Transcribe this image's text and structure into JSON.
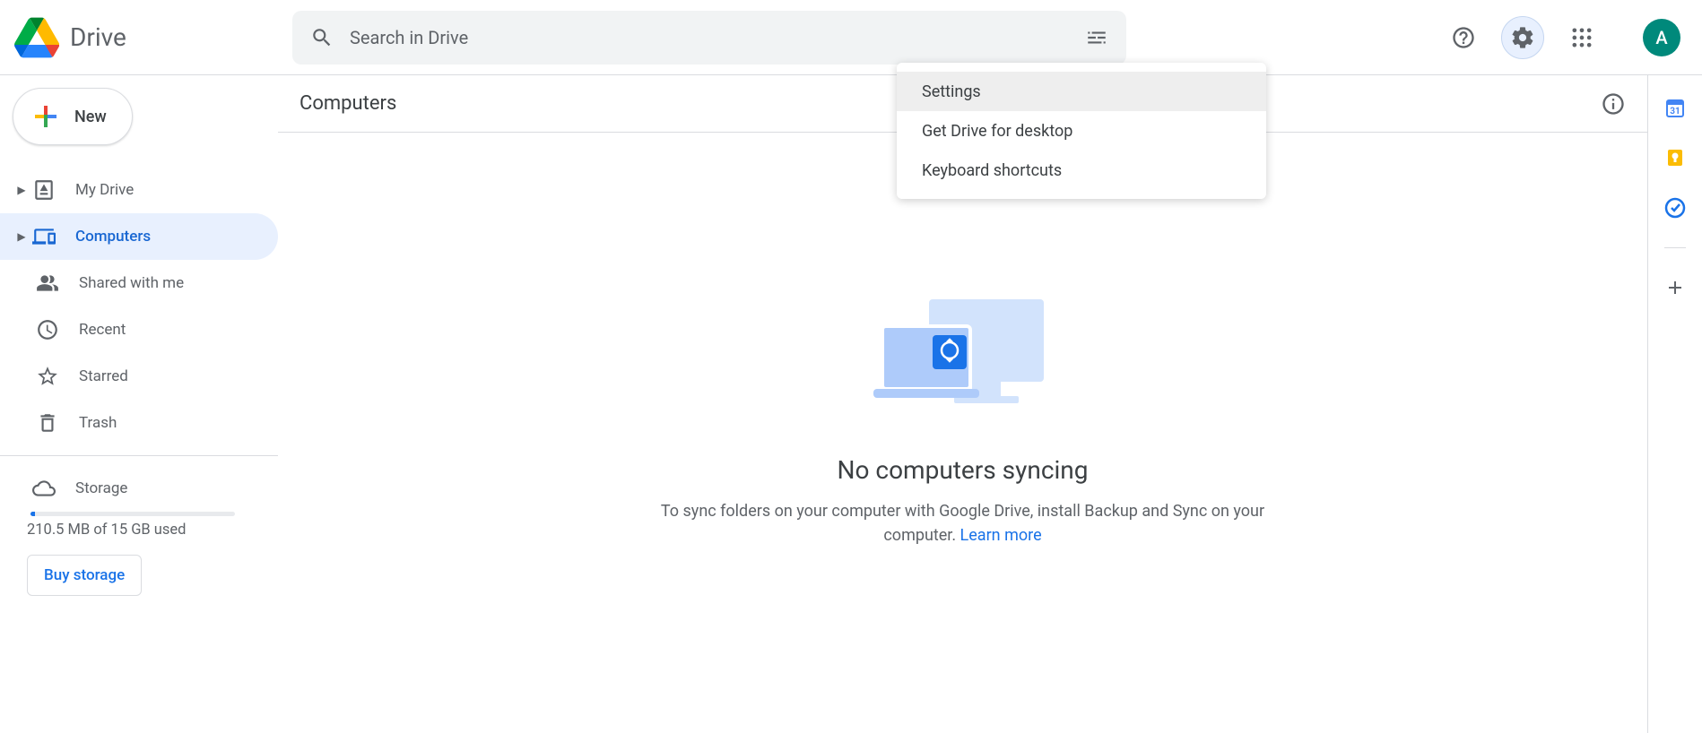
{
  "header": {
    "product_name": "Drive",
    "search_placeholder": "Search in Drive",
    "avatar_letter": "A"
  },
  "sidebar": {
    "new_label": "New",
    "items": [
      {
        "label": "My Drive"
      },
      {
        "label": "Computers"
      },
      {
        "label": "Shared with me"
      },
      {
        "label": "Recent"
      },
      {
        "label": "Starred"
      },
      {
        "label": "Trash"
      }
    ],
    "storage_label": "Storage",
    "storage_used_text": "210.5 MB of 15 GB used",
    "buy_storage_label": "Buy storage"
  },
  "main": {
    "title": "Computers",
    "empty_title": "No computers syncing",
    "empty_desc_prefix": "To sync folders on your computer with Google Drive, install Backup and Sync on your computer. ",
    "learn_more": "Learn more"
  },
  "settings_menu": {
    "items": [
      "Settings",
      "Get Drive for desktop",
      "Keyboard shortcuts"
    ]
  },
  "right_rail": {
    "calendar_day": "31"
  }
}
